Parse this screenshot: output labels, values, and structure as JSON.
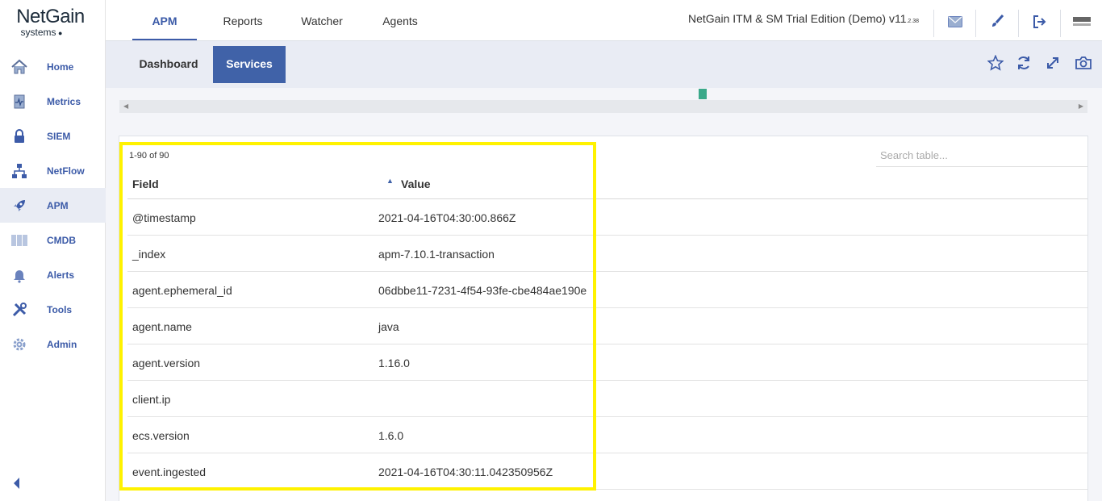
{
  "logo": {
    "main": "NetGain",
    "sub": "systems"
  },
  "sidebar": {
    "items": [
      {
        "label": "Home",
        "icon": "home-icon"
      },
      {
        "label": "Metrics",
        "icon": "metrics-icon"
      },
      {
        "label": "SIEM",
        "icon": "lock-icon"
      },
      {
        "label": "NetFlow",
        "icon": "network-icon"
      },
      {
        "label": "APM",
        "icon": "rocket-icon",
        "active": true
      },
      {
        "label": "CMDB",
        "icon": "barcode-icon"
      },
      {
        "label": "Alerts",
        "icon": "bell-icon"
      },
      {
        "label": "Tools",
        "icon": "tools-icon"
      },
      {
        "label": "Admin",
        "icon": "gear-icon"
      }
    ]
  },
  "topbar": {
    "tabs": [
      {
        "label": "APM",
        "active": true
      },
      {
        "label": "Reports"
      },
      {
        "label": "Watcher"
      },
      {
        "label": "Agents"
      }
    ],
    "edition": "NetGain ITM & SM Trial Edition (Demo) v11",
    "edition_build": ".2.38",
    "icons": [
      "mail-icon",
      "brush-icon",
      "logout-icon",
      "company-logo-icon"
    ]
  },
  "subbar": {
    "tabs": [
      {
        "label": "Dashboard"
      },
      {
        "label": "Services",
        "active": true
      }
    ],
    "icons": [
      "star-icon",
      "refresh-icon",
      "expand-icon",
      "camera-icon"
    ]
  },
  "table": {
    "count": "1-90 of 90",
    "search_placeholder": "Search table...",
    "headers": {
      "field": "Field",
      "value": "Value"
    },
    "rows": [
      {
        "field": "@timestamp",
        "value": "2021-04-16T04:30:00.866Z"
      },
      {
        "field": "_index",
        "value": "apm-7.10.1-transaction"
      },
      {
        "field": "agent.ephemeral_id",
        "value": "06dbbe11-7231-4f54-93fe-cbe484ae190e"
      },
      {
        "field": "agent.name",
        "value": "java"
      },
      {
        "field": "agent.version",
        "value": "1.16.0"
      },
      {
        "field": "client.ip",
        "value": ""
      },
      {
        "field": "ecs.version",
        "value": "1.6.0"
      },
      {
        "field": "event.ingested",
        "value": "2021-04-16T04:30:11.042350956Z"
      }
    ]
  },
  "colors": {
    "accent": "#3c5ba8",
    "active_tab_bg": "#4062a8",
    "highlight": "#fff200",
    "marker": "#3aa98a"
  }
}
